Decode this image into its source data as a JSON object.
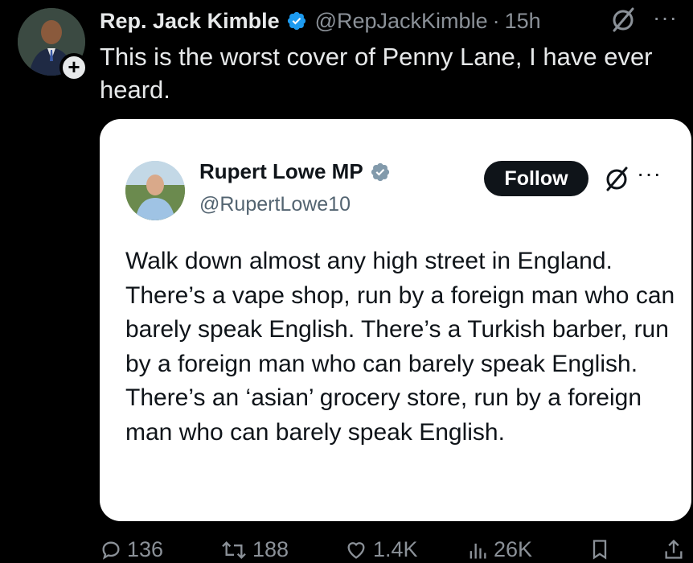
{
  "post": {
    "author_name": "Rep. Jack Kimble",
    "author_handle": "@RepJackKimble",
    "separator": "·",
    "timestamp": "15h",
    "follow_plus": "+",
    "more": "···",
    "text": "This is the worst cover of Penny Lane, I have ever heard.",
    "verified_color": "#1d9bf0"
  },
  "quote": {
    "author_name": "Rupert Lowe MP",
    "author_handle": "@RupertLowe10",
    "follow_label": "Follow",
    "more": "···",
    "verified_color": "#829aab",
    "text": "Walk down almost any high street in England. There’s a vape shop, run by a foreign man who can barely speak English. There’s a Turkish barber, run by a foreign man who can barely speak English. There’s an ‘asian’ grocery store, run by a foreign man who can barely speak English."
  },
  "actions": {
    "replies": "136",
    "reposts": "188",
    "likes": "1.4K",
    "views": "26K"
  },
  "icons": [
    "reply-icon",
    "repost-icon",
    "like-icon",
    "views-icon",
    "bookmark-icon",
    "share-icon",
    "grok-icon",
    "more-icon",
    "verified-badge-icon"
  ]
}
